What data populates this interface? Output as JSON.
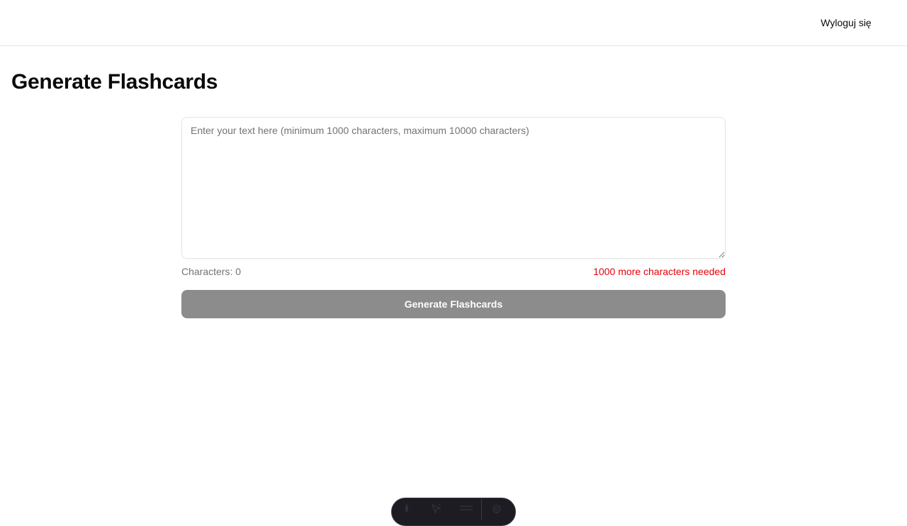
{
  "header": {
    "logout_label": "Wyloguj się"
  },
  "main": {
    "title": "Generate Flashcards",
    "textarea": {
      "value": "",
      "placeholder": "Enter your text here (minimum 1000 characters, maximum 10000 characters)"
    },
    "counter": {
      "label": "Characters: ",
      "value": "0",
      "needed_message": "1000 more characters needed"
    },
    "generate_label": "Generate Flashcards"
  },
  "dev_toolbar": {
    "icons": [
      "rocket-icon",
      "pointer-icon",
      "menu-icon",
      "gear-icon"
    ]
  },
  "colors": {
    "error": "#e7000b",
    "button_disabled": "#8c8c8c",
    "muted_text": "#737373",
    "border": "#e5e5e5"
  }
}
